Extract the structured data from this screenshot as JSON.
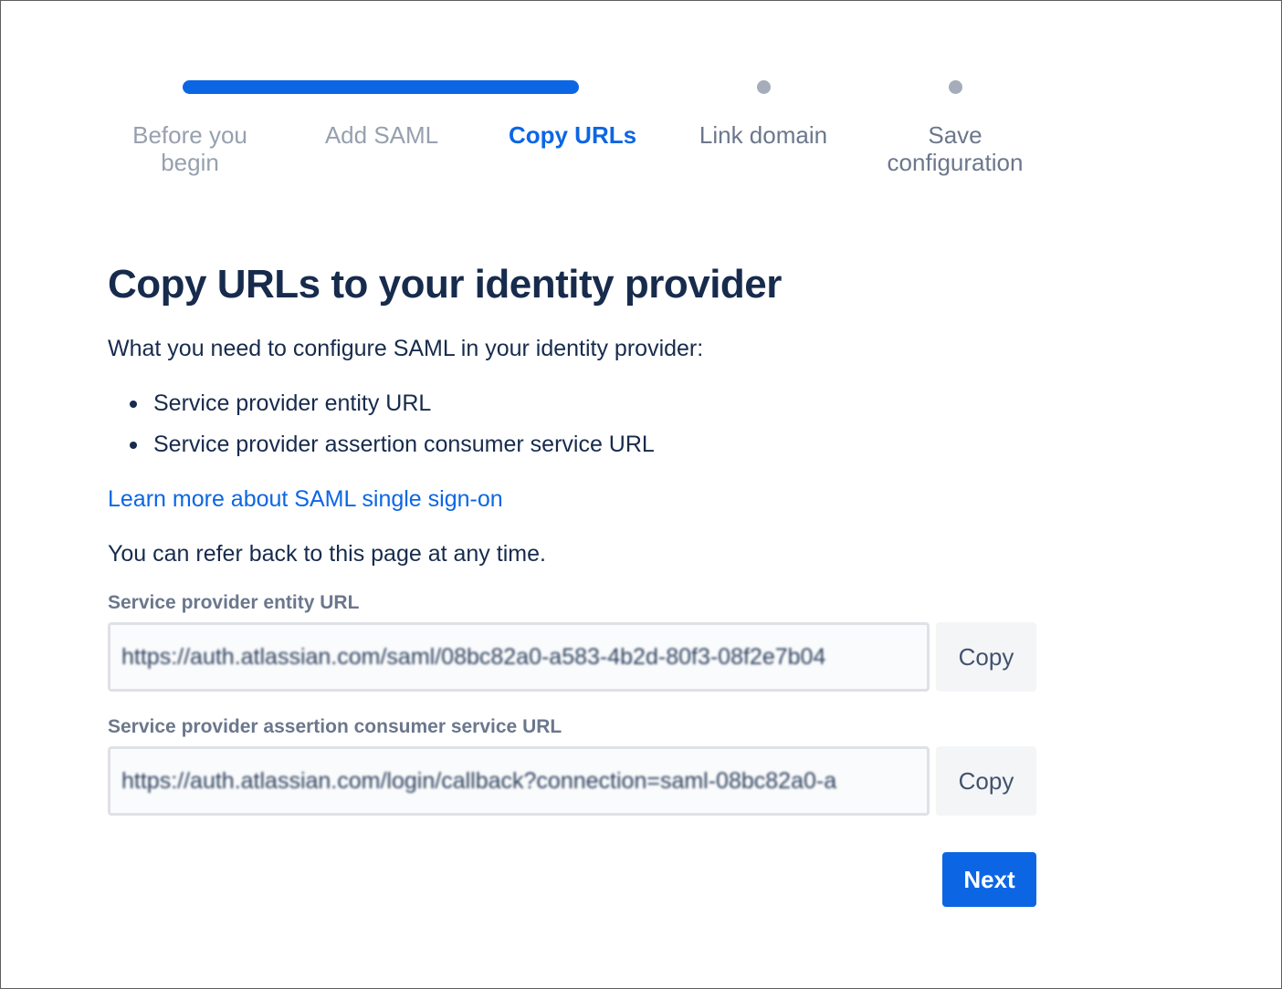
{
  "tracker": {
    "progress": 0.5,
    "steps": [
      {
        "line1": "Before you",
        "line2": "begin",
        "state": "done"
      },
      {
        "line1": "Add SAML",
        "line2": "",
        "state": "done"
      },
      {
        "line1": "Copy URLs",
        "line2": "",
        "state": "current"
      },
      {
        "line1": "Link domain",
        "line2": "",
        "state": "todo"
      },
      {
        "line1": "Save",
        "line2": "configuration",
        "state": "todo"
      }
    ]
  },
  "main": {
    "title": "Copy URLs to your identity provider",
    "intro": "What you need to configure SAML in your identity provider:",
    "bullets": [
      "Service provider entity URL",
      "Service provider assertion consumer service URL"
    ],
    "learn_link": "Learn more about SAML single sign-on",
    "refer_back": "You can refer back to this page at any time."
  },
  "fields": {
    "entity": {
      "label": "Service provider entity URL",
      "value": "https://auth.atlassian.com/saml/08bc82a0-a583-4b2d-80f3-08f2e7b04",
      "copy_label": "Copy"
    },
    "acs": {
      "label": "Service provider assertion consumer service URL",
      "value": "https://auth.atlassian.com/login/callback?connection=saml-08bc82a0-a",
      "copy_label": "Copy"
    }
  },
  "actions": {
    "next_label": "Next"
  },
  "colors": {
    "accent": "#0c66e4",
    "heading": "#172b4d",
    "muted": "#6b778c"
  }
}
